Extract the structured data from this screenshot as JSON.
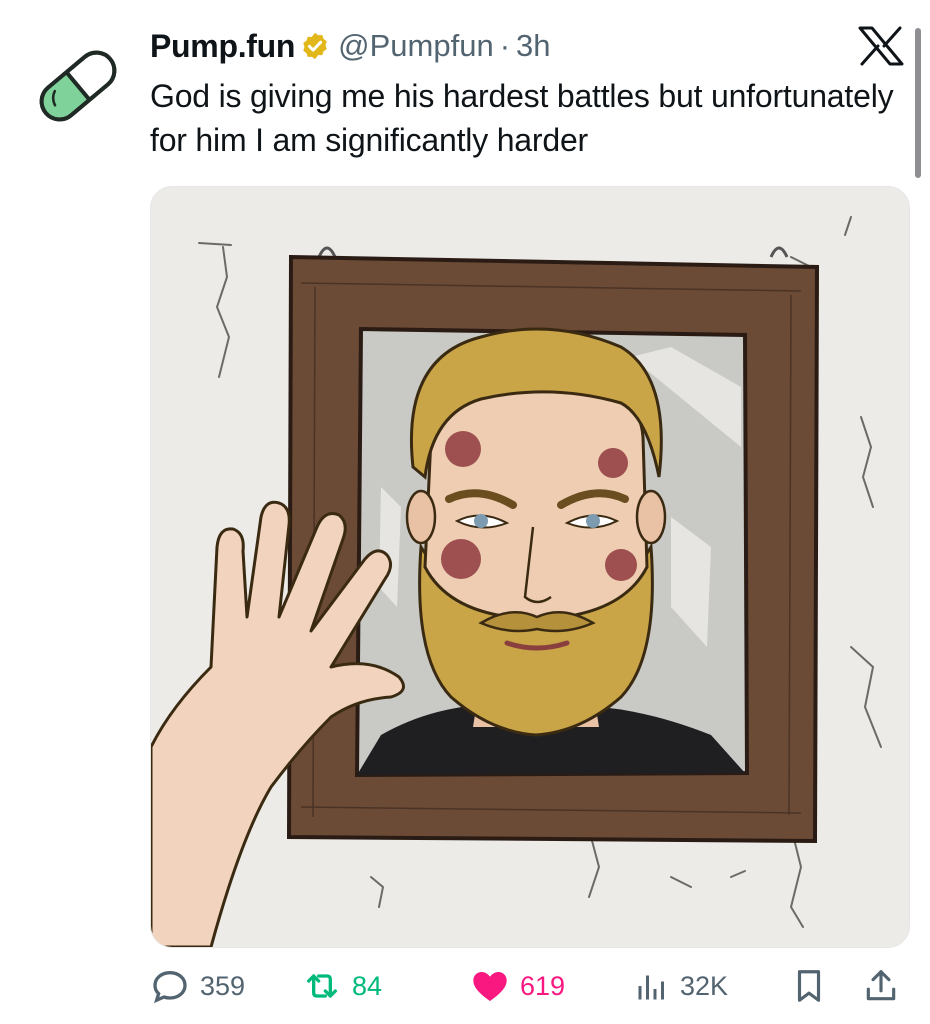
{
  "tweet": {
    "display_name": "Pump.fun",
    "verified_icon": "verified-gold-badge-icon",
    "handle": "@Pumpfun",
    "separator": "·",
    "time": "3h",
    "text": "God is giving me his hardest battles but unfortunately for him I am significantly harder",
    "avatar_icon": "green-pill-icon",
    "platform_icon": "x-logo-icon"
  },
  "media": {
    "description_icon": "bearded-man-in-mirror-illustration"
  },
  "actions": {
    "reply_count": "359",
    "retweet_count": "84",
    "like_count": "619",
    "views_count": "32K",
    "icons": [
      "reply-icon",
      "retweet-icon",
      "heart-icon",
      "views-icon",
      "bookmark-icon",
      "share-icon"
    ]
  },
  "colors": {
    "retweet": "#00ba7c",
    "like": "#f91880",
    "muted": "#536471",
    "verified_gold": "#e2b719",
    "pill_green": "#7fd39a"
  }
}
